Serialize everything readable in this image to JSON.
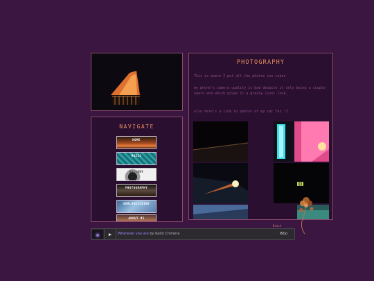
{
  "navigate": {
    "title": "NAVIGATE",
    "items": [
      {
        "label": "HOME"
      },
      {
        "label": "MUSIC"
      },
      {
        "label": "GALLERY"
      },
      {
        "label": "PHOTOGRAPHY"
      },
      {
        "label": "WORLDBUILDING"
      },
      {
        "label": "ABOUT ME"
      }
    ]
  },
  "main": {
    "title": "PHOTOGRAPHY",
    "intro": "This is where I put all the photos ive taken",
    "note": "my phone's camera quality is bad despite it only being a couple years and which gives it a grainy (ish) look.",
    "cat_link": "also here's a link to photos of my cat Taz :3"
  },
  "player": {
    "track_title": "Wherever you are",
    "by": " by ",
    "artist": "Kaito Chimera",
    "brand": "Wbo"
  },
  "credit": "Brush",
  "colors": {
    "background": "#3a1640",
    "panel": "#2a0f30",
    "border": "#8a4a6a",
    "heading": "#e58a5a",
    "body_text": "#8d4f88"
  }
}
